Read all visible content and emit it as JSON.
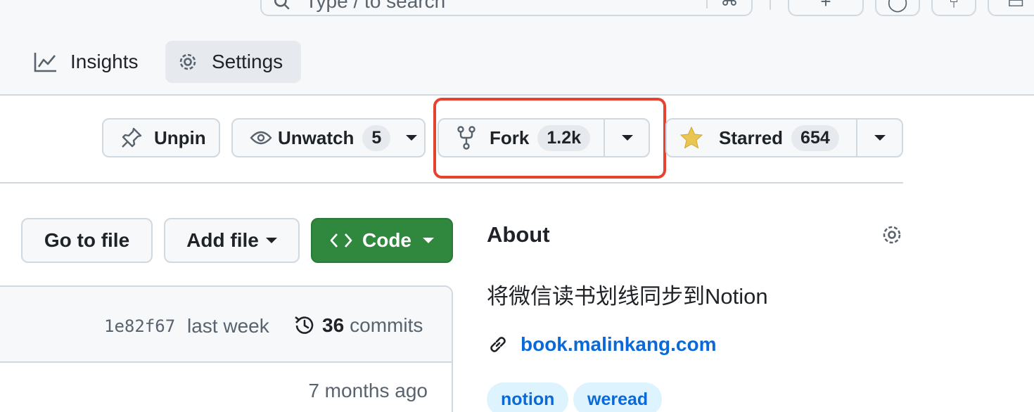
{
  "search": {
    "placeholder": "Type / to search",
    "shortcut": "⌘"
  },
  "top_buttons": [
    {
      "icon": "plus-icon",
      "glyph": "+"
    },
    {
      "icon": "issues-icon",
      "glyph": "◯"
    },
    {
      "icon": "pull-request-icon",
      "glyph": "⑂"
    },
    {
      "icon": "inbox-icon",
      "glyph": "▭"
    }
  ],
  "nav": {
    "insights_label": "Insights",
    "settings_label": "Settings"
  },
  "repo_actions": {
    "unpin_label": "Unpin",
    "unwatch_label": "Unwatch",
    "watch_count": "5",
    "fork_label": "Fork",
    "fork_count": "1.2k",
    "starred_label": "Starred",
    "star_count": "654",
    "star_color": "#eac54f"
  },
  "file_actions": {
    "go_to_file_label": "Go to file",
    "add_file_label": "Add file",
    "code_label": "Code",
    "code_color": "#2f883e"
  },
  "latest_commit": {
    "sha": "1e82f67",
    "time": "last week",
    "commit_count": "36",
    "commits_label": "commits"
  },
  "file_row": {
    "time": "7 months ago"
  },
  "about": {
    "title": "About",
    "description": "将微信读书划线同步到Notion",
    "website": "book.malinkang.com",
    "topics": [
      "notion",
      "weread"
    ]
  },
  "colors": {
    "highlight": "#e5432f",
    "link": "#0969da"
  }
}
